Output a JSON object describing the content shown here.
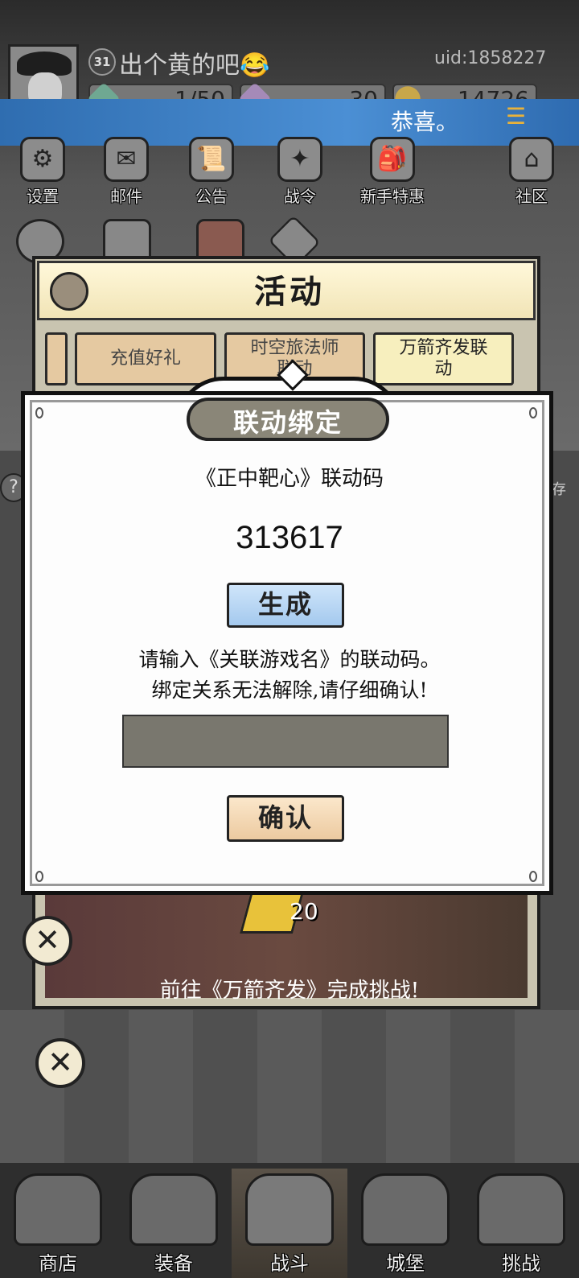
{
  "header": {
    "level": "31",
    "player_name": "出个黄的吧😂",
    "uid": "uid:1858227",
    "stamina": "1/50",
    "gems": "30",
    "coins": "14726"
  },
  "banner": {
    "text": "恭喜。",
    "menu_icon": "menu-icon"
  },
  "top_menu": [
    {
      "label": "设置",
      "icon": "gear-icon"
    },
    {
      "label": "邮件",
      "icon": "mail-icon"
    },
    {
      "label": "公告",
      "icon": "scroll-icon"
    },
    {
      "label": "战令",
      "icon": "battle-pass-icon"
    },
    {
      "label": "新手特惠",
      "icon": "gift-bag-icon"
    },
    {
      "label": "社区",
      "icon": "home-icon"
    }
  ],
  "activity": {
    "title": "活动",
    "tabs": [
      "充值好礼",
      "时空旅法师联动",
      "万箭齐发联动"
    ],
    "reward_count": "20",
    "description": "前往《万箭齐发》完成挑战!"
  },
  "dialog": {
    "title": "联动绑定",
    "code_label": "《正中靶心》联动码",
    "code_value": "313617",
    "generate_label": "生成",
    "instruction_line1": "请输入《关联游戏名》的联动码。",
    "instruction_line2": "绑定关系无法解除,请仔细确认!",
    "input_value": "",
    "confirm_label": "确认"
  },
  "side_text": "存",
  "bottom_nav": [
    {
      "label": "商店",
      "icon": "shop-icon"
    },
    {
      "label": "装备",
      "icon": "backpack-icon"
    },
    {
      "label": "战斗",
      "icon": "crossed-swords-icon"
    },
    {
      "label": "城堡",
      "icon": "castle-icon"
    },
    {
      "label": "挑战",
      "icon": "shield-icon"
    }
  ],
  "colors": {
    "banner_blue": "#3e82c8",
    "generate_button": "#b7d6f4",
    "confirm_button": "#f3d9b4",
    "input_fill": "#79776e"
  }
}
